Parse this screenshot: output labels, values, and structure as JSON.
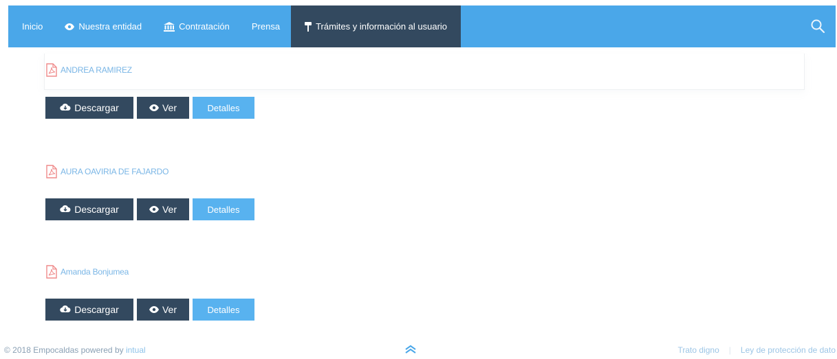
{
  "nav": {
    "items": [
      {
        "label": "Inicio",
        "icon": ""
      },
      {
        "label": "Nuestra entidad",
        "icon": "eye-icon"
      },
      {
        "label": "Contratación",
        "icon": "bank-icon"
      },
      {
        "label": "Prensa",
        "icon": ""
      },
      {
        "label": "Trámites y información al usuario",
        "icon": "pin-icon"
      }
    ],
    "active_index": 4,
    "search_icon": "search-icon"
  },
  "documents": [
    {
      "title": "ANDREA RAMIREZ",
      "icon": "pdf-file-icon"
    },
    {
      "title": "AURA OAVIRIA DE FAJARDO",
      "icon": "pdf-file-icon"
    },
    {
      "title": "Amanda Bonjumea",
      "icon": "pdf-file-icon"
    }
  ],
  "buttons": {
    "download_label": "Descargar",
    "view_label": "Ver",
    "details_label": "Detalles"
  },
  "footer": {
    "copyright": "© 2018 Empocaldas powered by",
    "powered_link": "intual",
    "links": [
      "Trato digno",
      "Ley de protección de dato"
    ],
    "scroll_icon": "double-chevron-up-icon"
  },
  "colors": {
    "nav_bg": "#4aa7e9",
    "nav_active_bg": "#33495f",
    "dark_button": "#33495f",
    "light_button": "#58b2ef",
    "doc_link": "#7ab6e6",
    "pdf_icon": "#ef8a8a"
  }
}
